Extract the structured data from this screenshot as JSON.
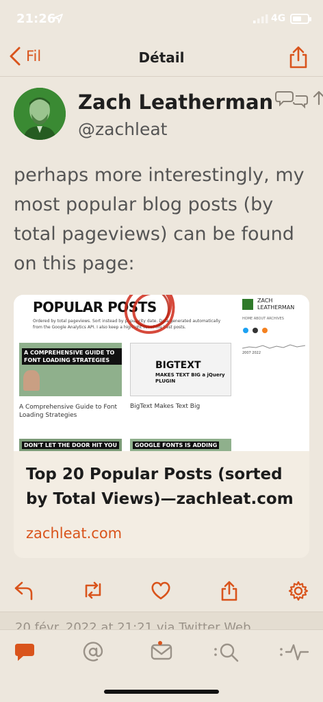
{
  "status_bar": {
    "time": "21:26",
    "network": "4G"
  },
  "nav": {
    "back_label": "Fil",
    "title": "Détail"
  },
  "author": {
    "name": "Zach Leatherman",
    "handle": "@zachleat"
  },
  "tweet": {
    "text": "perhaps more interestingly, my most popular blog posts (by total pageviews) can be found on this page:"
  },
  "card": {
    "title": "Top 20 Popular Posts (sorted by Total Views)—zachleat.com",
    "domain": "zachleat.com",
    "preview": {
      "heading": "POPULAR POSTS",
      "subtitle": "Ordered by total pageviews. Sort instead by popularity date. Data generated automatically from the Google Analytics API. I also keep a highlight list of my best posts.",
      "thumb1_label": "A COMPREHENSIVE GUIDE TO FONT LOADING STRATEGIES",
      "thumb1_caption": "A Comprehensive Guide to Font Loading Strategies",
      "thumb2_title": "BIGTEXT",
      "thumb2_sub": "MAKES TEXT BIG a jQuery PLUGIN",
      "thumb2_caption": "BigText Makes Text Big",
      "thumb3_label": "DON'T LET THE DOOR HIT YOU",
      "thumb4_label": "GOOGLE FONTS IS ADDING",
      "side_name": "ZACH LEATHERMAN",
      "side_nav": "HOME  ABOUT  ARCHIVES",
      "side_years": "2007                    2022"
    }
  },
  "meta": {
    "text": "20 févr. 2022 at 21:21 via Twitter Web"
  },
  "colors": {
    "accent": "#d9541c",
    "background": "#ede7dd"
  }
}
